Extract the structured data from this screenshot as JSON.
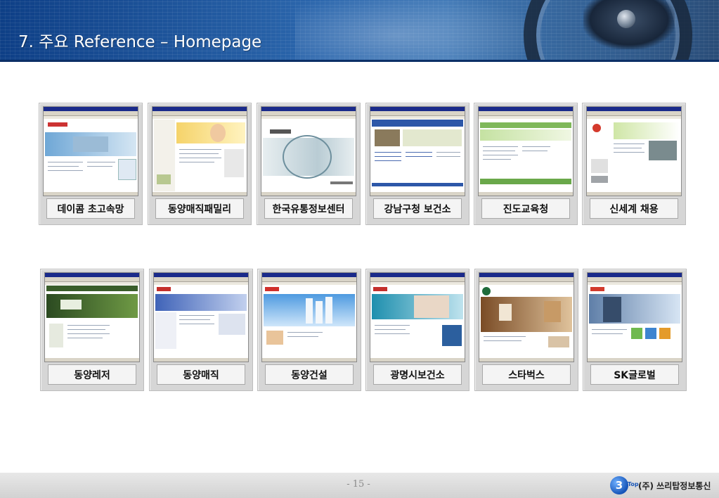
{
  "header": {
    "title": "7. 주요 Reference – Homepage"
  },
  "references": [
    {
      "label": "데이콤 초고속망"
    },
    {
      "label": "동양매직패밀리"
    },
    {
      "label": "한국유통정보센터"
    },
    {
      "label": "강남구청 보건소"
    },
    {
      "label": "진도교육청"
    },
    {
      "label": "신세계 채용"
    },
    {
      "label": "동양레저"
    },
    {
      "label": "동양매직"
    },
    {
      "label": "동양건설"
    },
    {
      "label": "광명시보건소"
    },
    {
      "label": "스타벅스"
    },
    {
      "label": "SK글로벌"
    }
  ],
  "footer": {
    "page_number": "- 15 -",
    "logo_mark": "3",
    "logo_top": "Top",
    "company_name": "(주) 쓰리탑정보통신"
  },
  "colors": {
    "header_blue": "#2c67ad",
    "card_gray": "#d6d6d6",
    "label_bg": "#f4f4f4",
    "footer_gray": "#d2d2d2",
    "logo_blue": "#1554b8"
  }
}
